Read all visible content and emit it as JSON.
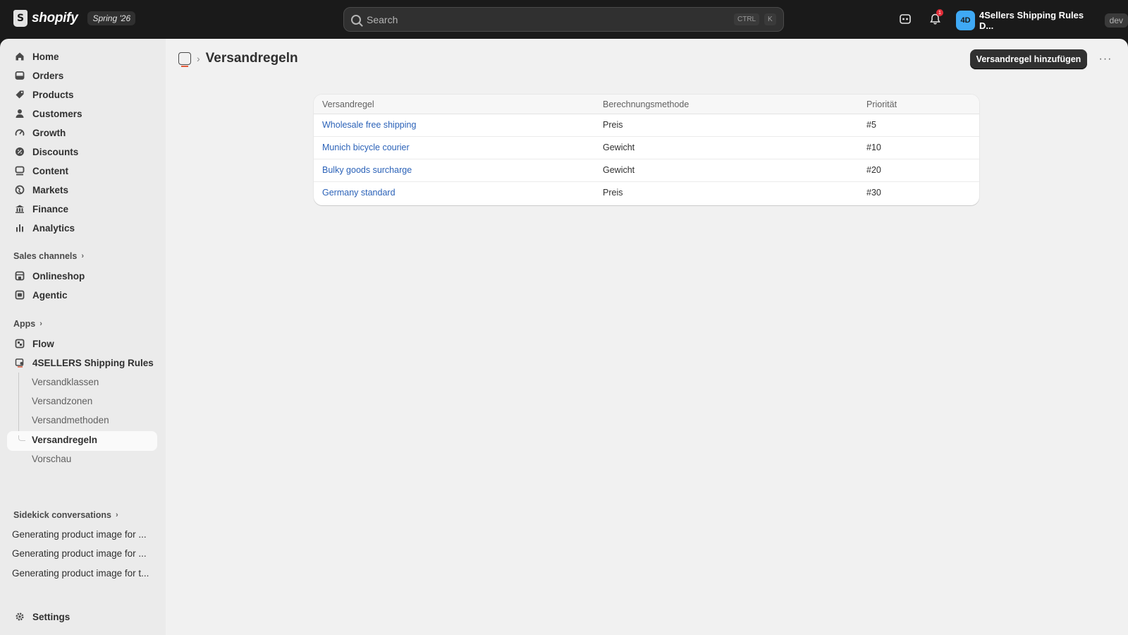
{
  "topbar": {
    "brand": "shopify",
    "brand_icon": "S",
    "edition": "Spring '26",
    "search_placeholder": "Search",
    "shortcut_ctrl": "CTRL",
    "shortcut_key": "K",
    "notification_count": "1",
    "store_initials": "4D",
    "store_name": "4Sellers Shipping Rules D...",
    "store_tag": "dev"
  },
  "sidebar": {
    "main_items": [
      {
        "label": "Home",
        "icon": "home-icon"
      },
      {
        "label": "Orders",
        "icon": "orders-icon"
      },
      {
        "label": "Products",
        "icon": "tag-icon"
      },
      {
        "label": "Customers",
        "icon": "person-icon"
      },
      {
        "label": "Growth",
        "icon": "gauge-icon"
      },
      {
        "label": "Discounts",
        "icon": "discount-icon"
      },
      {
        "label": "Content",
        "icon": "content-icon"
      },
      {
        "label": "Markets",
        "icon": "globe-icon"
      },
      {
        "label": "Finance",
        "icon": "bank-icon"
      },
      {
        "label": "Analytics",
        "icon": "bar-chart-icon"
      }
    ],
    "sales_channels_label": "Sales channels",
    "sales_channels": [
      {
        "label": "Onlineshop",
        "icon": "store-icon"
      },
      {
        "label": "Agentic",
        "icon": "robot-icon"
      }
    ],
    "apps_label": "Apps",
    "apps": [
      {
        "label": "Flow",
        "icon": "flow-icon"
      },
      {
        "label": "4SELLERS Shipping Rules",
        "icon": "shipping-app-icon"
      }
    ],
    "app_subitems": [
      "Versandklassen",
      "Versandzonen",
      "Versandmethoden",
      "Versandregeln",
      "Vorschau"
    ],
    "sidekick_label": "Sidekick conversations",
    "conversations": [
      "Generating product image for ...",
      "Generating product image for ...",
      "Generating product image for t..."
    ],
    "settings_label": "Settings"
  },
  "page": {
    "title": "Versandregeln",
    "primary_action": "Versandregel hinzufügen",
    "more_actions": "···"
  },
  "table": {
    "columns": [
      "Versandregel",
      "Berechnungsmethode",
      "Priorität"
    ],
    "rows": [
      [
        "Wholesale free shipping",
        "Preis",
        "#5"
      ],
      [
        "Munich bicycle courier",
        "Gewicht",
        "#10"
      ],
      [
        "Bulky goods surcharge",
        "Gewicht",
        "#20"
      ],
      [
        "Germany standard",
        "Preis",
        "#30"
      ]
    ]
  },
  "colors": {
    "topbar": "#1a1a1a",
    "sidebar": "#ebebeb",
    "main": "#f1f1f1",
    "link": "#2b62b8",
    "primary_button": "#303030",
    "store_avatar": "#3fa9f5",
    "notification": "#e22c38"
  }
}
